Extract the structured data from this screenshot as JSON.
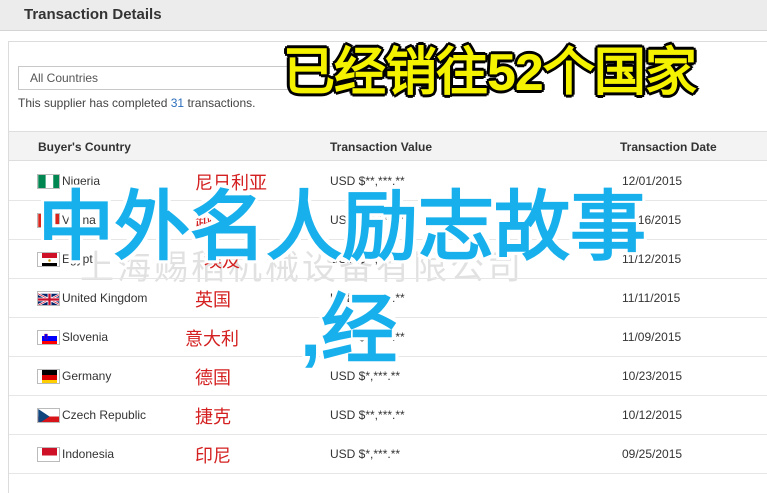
{
  "header": {
    "title": "Transaction Details"
  },
  "filter": {
    "selected": "All Countries"
  },
  "summary": {
    "prefix": "This supplier has completed ",
    "count": "31",
    "suffix": " transactions."
  },
  "table": {
    "columns": [
      "Buyer's Country",
      "Transaction Value",
      "Transaction Date"
    ],
    "rows": [
      {
        "country": "Nigeria",
        "cn": "尼日利亚",
        "value": "USD $**,***.**",
        "date": "12/01/2015",
        "flag": "nigeria-flag-icon"
      },
      {
        "country": "Vietnam",
        "cn": "越南",
        "value": "USD $**,***.**",
        "date": "11/16/2015",
        "flag": "vietnam-flag-icon"
      },
      {
        "country": "Egypt",
        "cn": "埃及",
        "value": "USD $**,***.**",
        "date": "11/12/2015",
        "flag": "egypt-flag-icon"
      },
      {
        "country": "United Kingdom",
        "cn": "英国",
        "value": "USD $**,***.**",
        "date": "11/11/2015",
        "flag": "uk-flag-icon"
      },
      {
        "country": "Slovenia",
        "cn": "意大利",
        "value": "USD $**,***.**",
        "date": "11/09/2015",
        "flag": "slovenia-flag-icon"
      },
      {
        "country": "Germany",
        "cn": "德国",
        "value": "USD $*,***.**",
        "date": "10/23/2015",
        "flag": "germany-flag-icon"
      },
      {
        "country": "Czech Republic",
        "cn": "捷克",
        "value": "USD $**,***.**",
        "date": "10/12/2015",
        "flag": "czech-flag-icon"
      },
      {
        "country": "Indonesia",
        "cn": "印尼",
        "value": "USD $*,***.**",
        "date": "09/25/2015",
        "flag": "indonesia-flag-icon"
      }
    ]
  },
  "watermark": "上海赐稻机械设备有限公司",
  "overlay": {
    "top": "已经销往52个国家",
    "big": "中外名人励志故事",
    "jing": ",经"
  },
  "colors": {
    "overlay_yellow": "#f5f200",
    "overlay_blue": "#17b0ec",
    "cn_red": "#d42020",
    "link_blue": "#2a6ebb"
  }
}
